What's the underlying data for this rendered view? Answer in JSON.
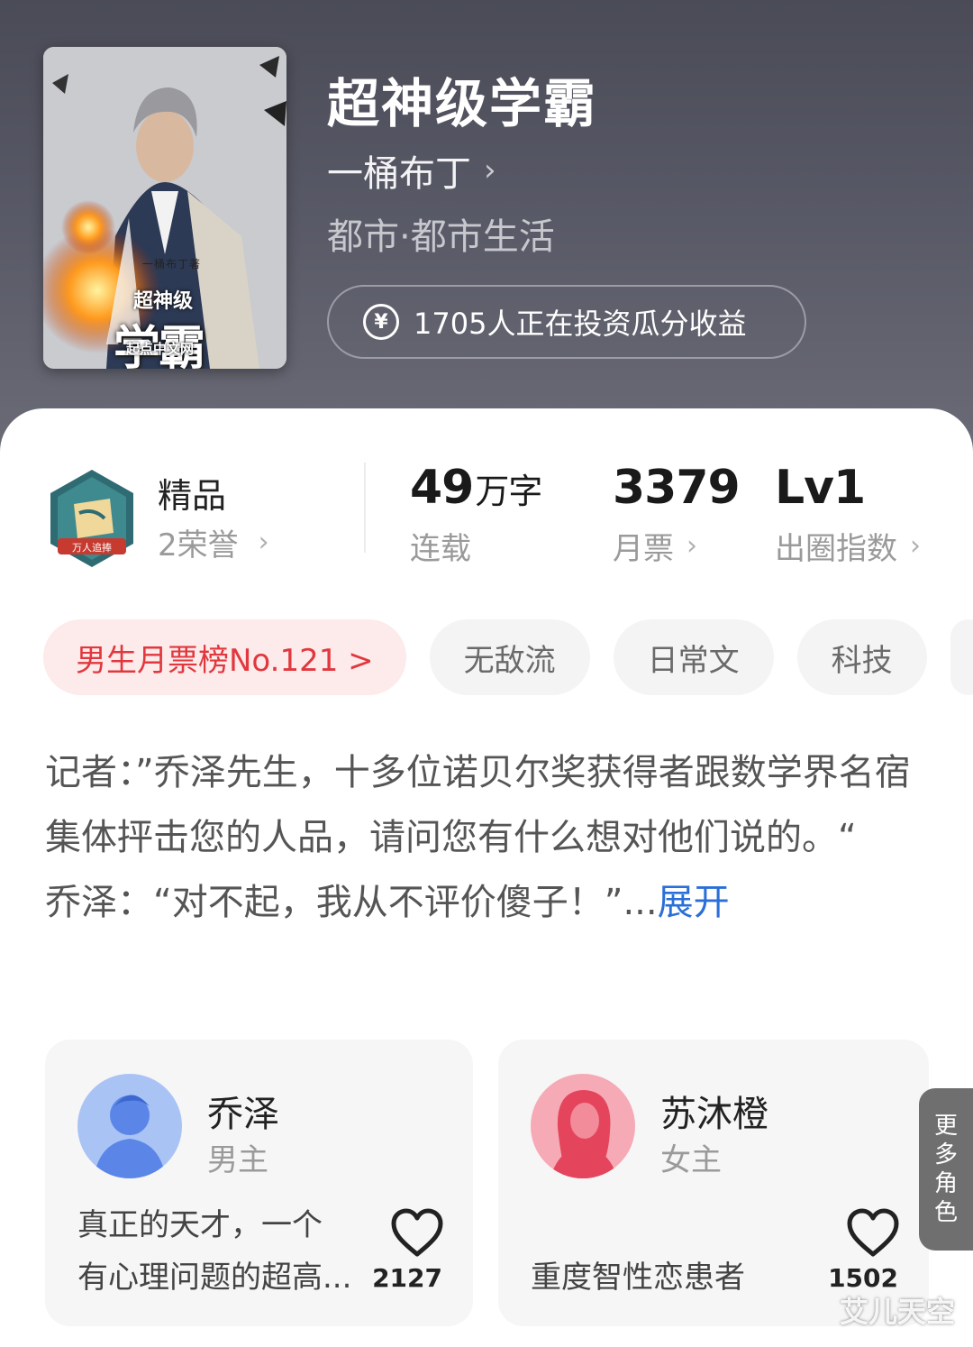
{
  "header": {
    "book_title": "超神级学霸",
    "author": "一桶布丁",
    "genre": "都市·都市生活",
    "invest_text": "1705人正在投资瓜分收益",
    "cover": {
      "author": "一桶布丁著",
      "series": "超神级",
      "title": "学霸",
      "publisher": "起点中文网"
    }
  },
  "stats": {
    "quality": "精品",
    "honor": "2荣誉",
    "badge_text": "万人追捧",
    "words_value": "49",
    "words_unit": "万字",
    "words_label": "连载",
    "monthly_votes_value": "3379",
    "monthly_votes_label": "月票",
    "circle_index_value": "Lv1",
    "circle_index_label": "出圈指数"
  },
  "tags": [
    "男生月票榜No.121 >",
    "无敌流",
    "日常文",
    "科技"
  ],
  "synopsis": {
    "line1": "记者：”乔泽先生，十多位诺贝尔奖获得者跟数学界名宿集体抨击您的人品，请问您有什么想对他们说的。“",
    "line2": "乔泽：“对不起，我从不评价傻子！”...",
    "expand": "展开"
  },
  "roles": [
    {
      "name": "乔泽",
      "type": "男主",
      "desc_line1": "真正的天才，一个",
      "desc_line2": "有心理问题的超高...",
      "likes": "2127"
    },
    {
      "name": "苏沐橙",
      "type": "女主",
      "desc_line1": "",
      "desc_line2": "重度智性恋患者",
      "likes": "1502"
    }
  ],
  "more_roles": [
    "更",
    "多",
    "角",
    "色"
  ],
  "watermark": "艾儿天空",
  "colors": {
    "accent_red": "#e0383e",
    "link_blue": "#2a6fd8",
    "hero_bg": "#55565f"
  }
}
